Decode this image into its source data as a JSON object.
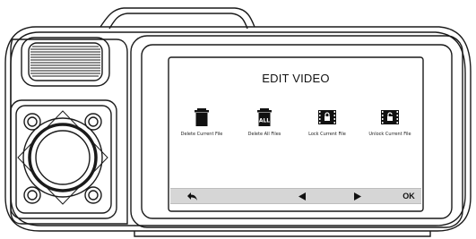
{
  "screen": {
    "title": "EDIT VIDEO",
    "menu_items": [
      {
        "label": "Delete Current File",
        "icon": "trash-icon"
      },
      {
        "label": "Delete All Files",
        "icon": "delete-all-icon",
        "badge": "ALL"
      },
      {
        "label": "Lock Current File",
        "icon": "lock-file-icon"
      },
      {
        "label": "Unlock Current File",
        "icon": "unlock-file-icon"
      }
    ]
  },
  "bottom_bar": {
    "back_icon": "back-arrow-icon",
    "left_icon": "left-triangle-icon",
    "right_icon": "right-triangle-icon",
    "ok_label": "OK"
  },
  "colors": {
    "screen_background": "#ffffff",
    "bar_background": "#d6d6d6",
    "device_outline": "#1a1a1a"
  }
}
